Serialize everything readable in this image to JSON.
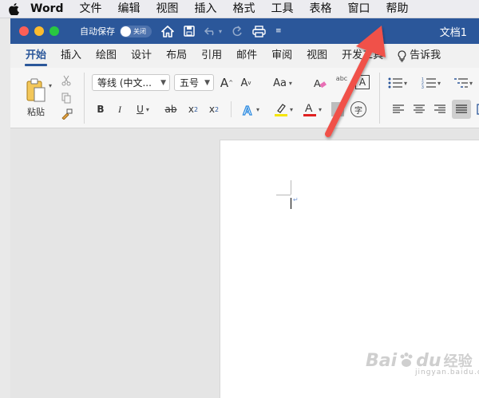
{
  "menubar": {
    "app_name": "Word",
    "items": [
      "文件",
      "编辑",
      "视图",
      "插入",
      "格式",
      "工具",
      "表格",
      "窗口",
      "帮助"
    ]
  },
  "titlebar": {
    "autosave_label": "自动保存",
    "autosave_state": "关闭",
    "doc_title": "文档1",
    "color": "#2b579a"
  },
  "tabs": {
    "items": [
      "开始",
      "插入",
      "绘图",
      "设计",
      "布局",
      "引用",
      "邮件",
      "审阅",
      "视图",
      "开发工具"
    ],
    "active": "开始",
    "tell_me": "告诉我"
  },
  "ribbon": {
    "paste_label": "粘贴",
    "font_name": "等线 (中文...",
    "font_size": "五号",
    "grow_font": "A",
    "shrink_font": "A",
    "change_case": "Aa",
    "phonetic": "abc",
    "char_border": "A",
    "bold": "B",
    "italic": "I",
    "underline": "U",
    "strike": "ab",
    "subscript": "x",
    "superscript": "x",
    "sub_digit": "2",
    "super_digit": "2",
    "highlight_color": "#f5e507",
    "font_color": "#e02020",
    "enclose_char": "字"
  },
  "watermark": {
    "brand": "Bai",
    "brand2": "du",
    "suffix": "经验",
    "url": "jingyan.baidu.com"
  },
  "annotation": {
    "arrow_color": "#f0514a"
  }
}
